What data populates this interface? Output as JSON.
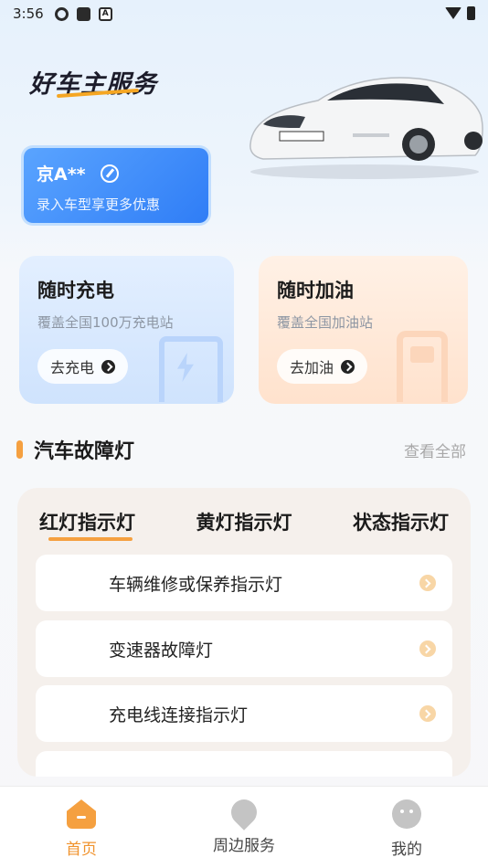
{
  "status_bar": {
    "time": "3:56"
  },
  "header": {
    "brand": "好车主服务"
  },
  "plate_card": {
    "plate": "京A**",
    "subtitle": "录入车型享更多优惠"
  },
  "services": [
    {
      "title": "随时充电",
      "subtitle": "覆盖全国100万充电站",
      "button": "去充电"
    },
    {
      "title": "随时加油",
      "subtitle": "覆盖全国加油站",
      "button": "去加油"
    }
  ],
  "fault_lights": {
    "title": "汽车故障灯",
    "view_all": "查看全部",
    "tabs": [
      "红灯指示灯",
      "黄灯指示灯",
      "状态指示灯"
    ],
    "items": [
      "车辆维修或保养指示灯",
      "变速器故障灯",
      "充电线连接指示灯"
    ]
  },
  "bottom_nav": [
    {
      "label": "首页",
      "icon": "home-icon",
      "active": true
    },
    {
      "label": "周边服务",
      "icon": "nearby-icon",
      "active": false
    },
    {
      "label": "我的",
      "icon": "profile-icon",
      "active": false
    }
  ],
  "colors": {
    "accent": "#f5a040",
    "blue": "#2f7df6"
  }
}
